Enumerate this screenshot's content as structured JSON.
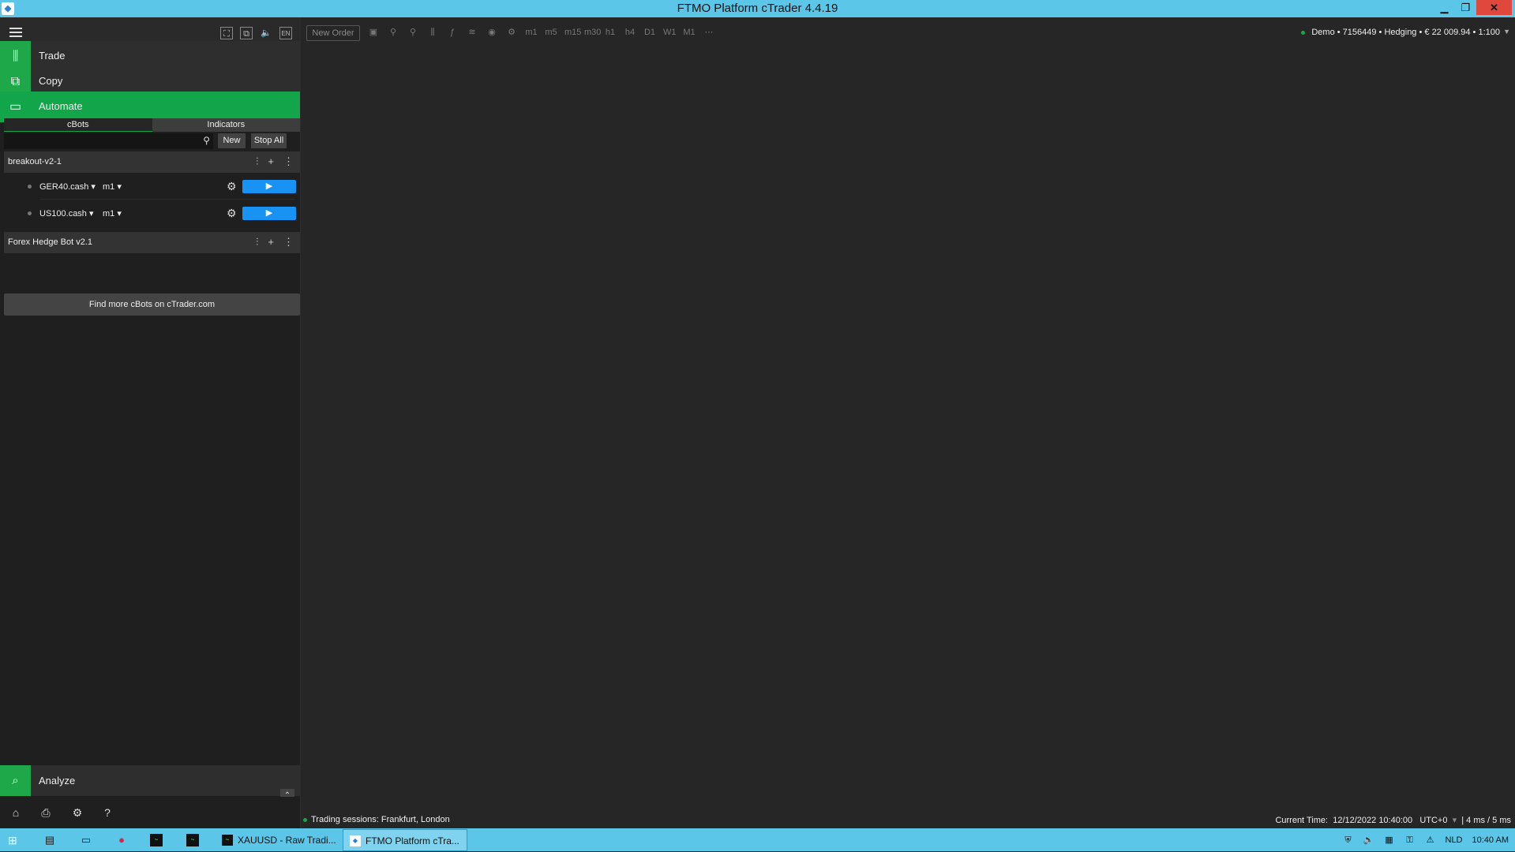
{
  "window": {
    "title": "FTMO Platform cTrader 4.4.19"
  },
  "left_panel": {
    "tool_icons": [
      "fullscreen-icon",
      "detach-icon",
      "mute-icon",
      "language-icon"
    ],
    "language": "EN",
    "nav": [
      {
        "label": "Trade",
        "icon": "trade-icon"
      },
      {
        "label": "Copy",
        "icon": "copy-icon"
      },
      {
        "label": "Automate",
        "icon": "automate-icon"
      }
    ],
    "tabs": [
      "cBots",
      "Indicators"
    ],
    "search": {
      "placeholder": "",
      "value": ""
    },
    "new_label": "New",
    "stop_all_label": "Stop All",
    "bots": [
      {
        "name": "breakout-v2-1",
        "instances": [
          {
            "symbol": "GER40.cash",
            "timeframe": "m1"
          },
          {
            "symbol": "US100.cash",
            "timeframe": "m1"
          }
        ]
      },
      {
        "name": "Forex Hedge Bot v2.1",
        "instances": []
      }
    ],
    "find_more": "Find more cBots on cTrader.com",
    "analyze_label": "Analyze"
  },
  "toolbar": {
    "new_order": "New Order",
    "timeframes": [
      "m1",
      "m5",
      "m15",
      "m30",
      "h1",
      "h4",
      "D1",
      "W1",
      "M1"
    ],
    "account": "Demo • 7156449 • Hedging • € 22 009.94 • 1:100"
  },
  "status": {
    "sessions": "Trading sessions: Frankfurt, London",
    "current_time_label": "Current Time:",
    "current_time": "12/12/2022 10:40:00",
    "timezone": "UTC+0",
    "latency": "4 ms / 5 ms"
  },
  "taskbar": {
    "tasks": [
      {
        "label": "XAUUSD - Raw Tradi...",
        "active": false
      },
      {
        "label": "FTMO Platform cTra...",
        "active": true
      }
    ],
    "language": "NLD",
    "clock": "10:40 AM"
  },
  "colors": {
    "accent_green": "#12a54a",
    "play_blue": "#1893f3",
    "titlebar": "#5bc6e8"
  }
}
